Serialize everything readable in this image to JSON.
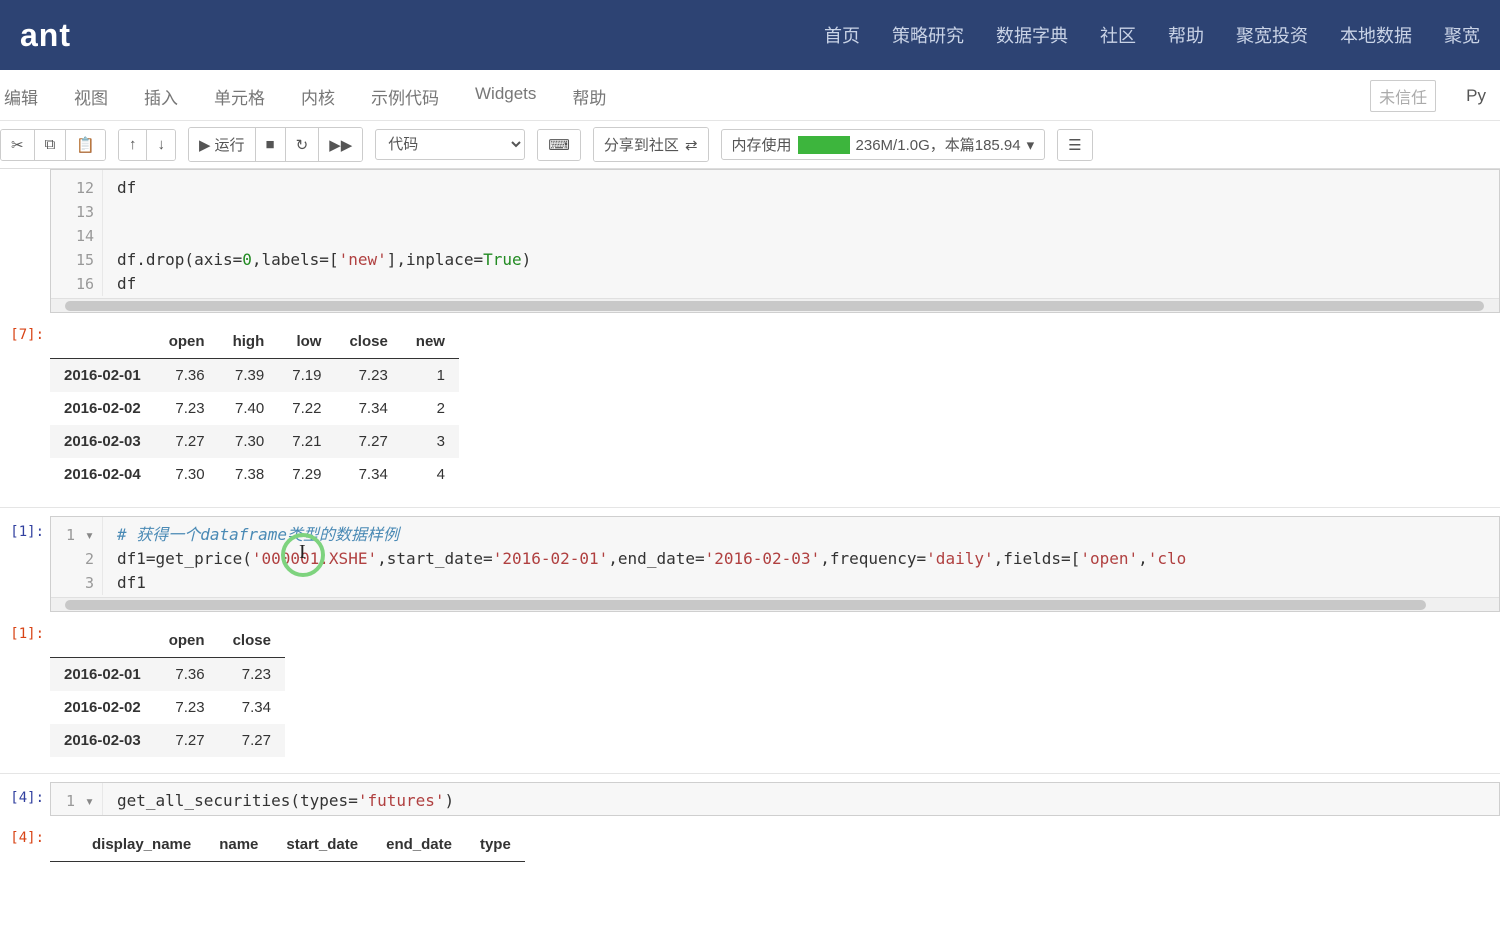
{
  "brand": "ant",
  "nav_links": [
    "首页",
    "策略研究",
    "数据字典",
    "社区",
    "帮助",
    "聚宽投资",
    "本地数据",
    "聚宽"
  ],
  "menu_items": [
    "编辑",
    "视图",
    "插入",
    "单元格",
    "内核",
    "示例代码",
    "Widgets",
    "帮助"
  ],
  "trust_label": "未信任",
  "kernel_label": "Py",
  "toolbar": {
    "run": "运行",
    "celltype": "代码",
    "share": "分享到社区",
    "mem_prefix": "内存使用",
    "mem_text": "236M/1.0G，本篇185.94",
    "mem_caret": "▾"
  },
  "cells": {
    "c0": {
      "gutter": [
        "12",
        "13",
        "14",
        "15",
        "16"
      ],
      "line12": "df",
      "line15_a": "df.drop(axis=",
      "line15_b": "0",
      "line15_c": ",labels=[",
      "line15_d": "'new'",
      "line15_e": "],inplace=",
      "line15_f": "True",
      "line15_g": ")",
      "line16": "df"
    },
    "out7_label": "[7]:",
    "out7_table": {
      "cols": [
        "open",
        "high",
        "low",
        "close",
        "new"
      ],
      "rows": [
        {
          "idx": "2016-02-01",
          "v": [
            "7.36",
            "7.39",
            "7.19",
            "7.23",
            "1"
          ]
        },
        {
          "idx": "2016-02-02",
          "v": [
            "7.23",
            "7.40",
            "7.22",
            "7.34",
            "2"
          ]
        },
        {
          "idx": "2016-02-03",
          "v": [
            "7.27",
            "7.30",
            "7.21",
            "7.27",
            "3"
          ]
        },
        {
          "idx": "2016-02-04",
          "v": [
            "7.30",
            "7.38",
            "7.29",
            "7.34",
            "4"
          ]
        }
      ]
    },
    "in1_label": "[1]:",
    "c1": {
      "gutter": [
        "1",
        "2",
        "3"
      ],
      "line1": "# 获得一个dataframe类型的数据样例",
      "line2_a": "df1=get_price(",
      "line2_b": "'000001.XSHE'",
      "line2_c": ",start_date=",
      "line2_d": "'2016-02-01'",
      "line2_e": ",end_date=",
      "line2_f": "'2016-02-03'",
      "line2_g": ",frequency=",
      "line2_h": "'daily'",
      "line2_i": ",fields=[",
      "line2_j": "'open'",
      "line2_k": ",",
      "line2_l": "'clo",
      "line3": "df1"
    },
    "out1_label": "[1]:",
    "out1_table": {
      "cols": [
        "open",
        "close"
      ],
      "rows": [
        {
          "idx": "2016-02-01",
          "v": [
            "7.36",
            "7.23"
          ]
        },
        {
          "idx": "2016-02-02",
          "v": [
            "7.23",
            "7.34"
          ]
        },
        {
          "idx": "2016-02-03",
          "v": [
            "7.27",
            "7.27"
          ]
        }
      ]
    },
    "in4_label": "[4]:",
    "c4": {
      "gutter": [
        "1"
      ],
      "line1_a": "get_all_securities(types=",
      "line1_b": "'futures'",
      "line1_c": ")"
    },
    "out4_label": "[4]:",
    "out4_table": {
      "cols": [
        "display_name",
        "name",
        "start_date",
        "end_date",
        "type"
      ]
    }
  }
}
